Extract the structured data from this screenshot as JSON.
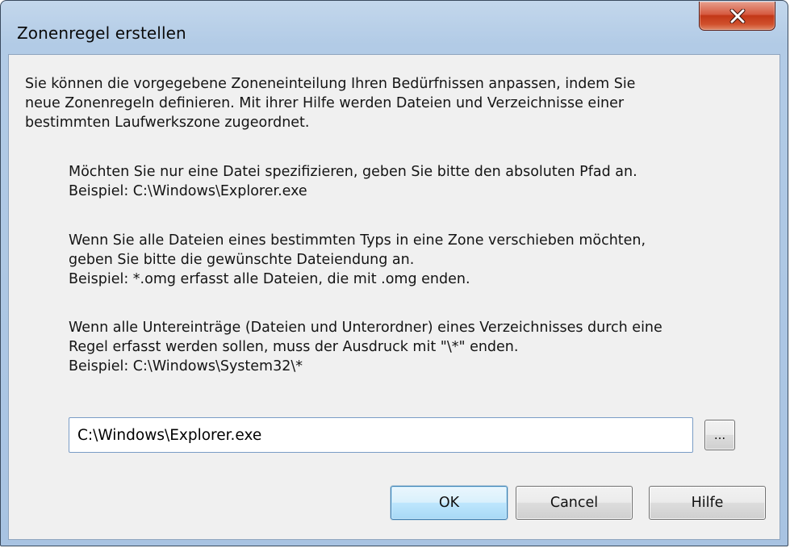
{
  "dialog": {
    "title": "Zonenregel erstellen",
    "close_glyph": "x",
    "intro_lines": [
      "Sie können die vorgegebene Zoneneinteilung Ihren Bedürfnissen anpassen, indem Sie",
      "neue Zonenregeln definieren. Mit ihrer Hilfe werden Dateien und Verzeichnisse einer",
      "bestimmten Laufwerkszone zugeordnet."
    ],
    "hint1_lines": [
      "Möchten Sie nur eine Datei spezifizieren, geben Sie bitte den absoluten Pfad an.",
      "Beispiel: C:\\Windows\\Explorer.exe"
    ],
    "hint2_lines": [
      "Wenn Sie alle Dateien eines bestimmten Typs in eine Zone verschieben möchten,",
      "geben Sie bitte die gewünschte Dateiendung an.",
      "Beispiel: *.omg erfasst alle Dateien, die mit .omg enden."
    ],
    "hint3_lines": [
      "Wenn alle Untereinträge (Dateien und Unterordner) eines Verzeichnisses durch eine",
      "Regel erfasst werden sollen, muss der Ausdruck mit \"\\*\" enden.",
      "Beispiel: C:\\Windows\\System32\\*"
    ],
    "path_input_value": "C:\\Windows\\Explorer.exe",
    "browse_label": "...",
    "ok_label": "OK",
    "cancel_label": "Cancel",
    "help_label": "Hilfe",
    "colors": {
      "close_button": "#c7411f",
      "frame": "#b2cbe6",
      "client": "#f0f0f0",
      "default_button": "#bee6fd"
    }
  }
}
